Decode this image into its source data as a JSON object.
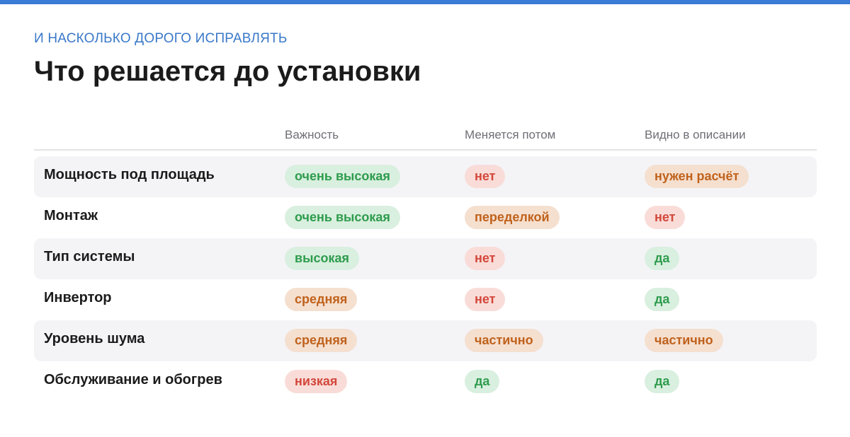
{
  "header": {
    "eyebrow": "И НАСКОЛЬКО ДОРОГО ИСПРАВЛЯТЬ",
    "title": "Что решается до установки"
  },
  "colors": {
    "accent": "#3a7bd5",
    "green_text": "#2e9c4d",
    "green_bg": "#d9efdf",
    "orange_text": "#c0621c",
    "orange_bg": "#f5dfcf",
    "red_text": "#d2473a",
    "red_bg": "#f9dcd8"
  },
  "table": {
    "columns": [
      "",
      "Важность",
      "Меняется потом",
      "Видно в описании"
    ],
    "rows": [
      {
        "label": "Мощность под площадь",
        "importance": {
          "text": "очень высокая",
          "tone": "green"
        },
        "changes_later": {
          "text": "нет",
          "tone": "red"
        },
        "in_description": {
          "text": "нужен расчёт",
          "tone": "orange"
        }
      },
      {
        "label": "Монтаж",
        "importance": {
          "text": "очень высокая",
          "tone": "green"
        },
        "changes_later": {
          "text": "переделкой",
          "tone": "orange"
        },
        "in_description": {
          "text": "нет",
          "tone": "red"
        }
      },
      {
        "label": "Тип системы",
        "importance": {
          "text": "высокая",
          "tone": "green"
        },
        "changes_later": {
          "text": "нет",
          "tone": "red"
        },
        "in_description": {
          "text": "да",
          "tone": "green"
        }
      },
      {
        "label": "Инвертор",
        "importance": {
          "text": "средняя",
          "tone": "orange"
        },
        "changes_later": {
          "text": "нет",
          "tone": "red"
        },
        "in_description": {
          "text": "да",
          "tone": "green"
        }
      },
      {
        "label": "Уровень шума",
        "importance": {
          "text": "средняя",
          "tone": "orange"
        },
        "changes_later": {
          "text": "частично",
          "tone": "orange"
        },
        "in_description": {
          "text": "частично",
          "tone": "orange"
        }
      },
      {
        "label": "Обслуживание и обогрев",
        "importance": {
          "text": "низкая",
          "tone": "red"
        },
        "changes_later": {
          "text": "да",
          "tone": "green"
        },
        "in_description": {
          "text": "да",
          "tone": "green"
        }
      }
    ]
  }
}
